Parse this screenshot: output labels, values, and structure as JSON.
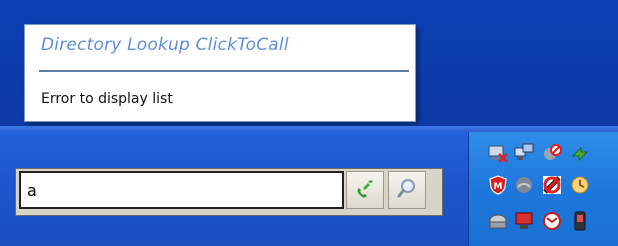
{
  "popup": {
    "title": "Directory Lookup ClickToCall",
    "message": "Error to display list"
  },
  "toolbar": {
    "search_value": "a",
    "call_button_icon": "phone-handset-icon",
    "search_button_icon": "magnifier-icon"
  },
  "tray": {
    "icons": [
      "network-muted-icon",
      "network-computer-icon",
      "shield-prohibited-icon",
      "green-arrows-icon",
      "mcafee-shield-icon",
      "gray-shield-icon",
      "signal-blocked-icon",
      "clock-orange-icon",
      "drive-icon",
      "computer-red-icon",
      "gmail-icon",
      "phone-device-icon"
    ]
  },
  "colors": {
    "desktop": "#0b3fb4",
    "taskbar": "#2560dc",
    "tray": "#2f8de8",
    "popup_title": "#5f8fd6"
  }
}
